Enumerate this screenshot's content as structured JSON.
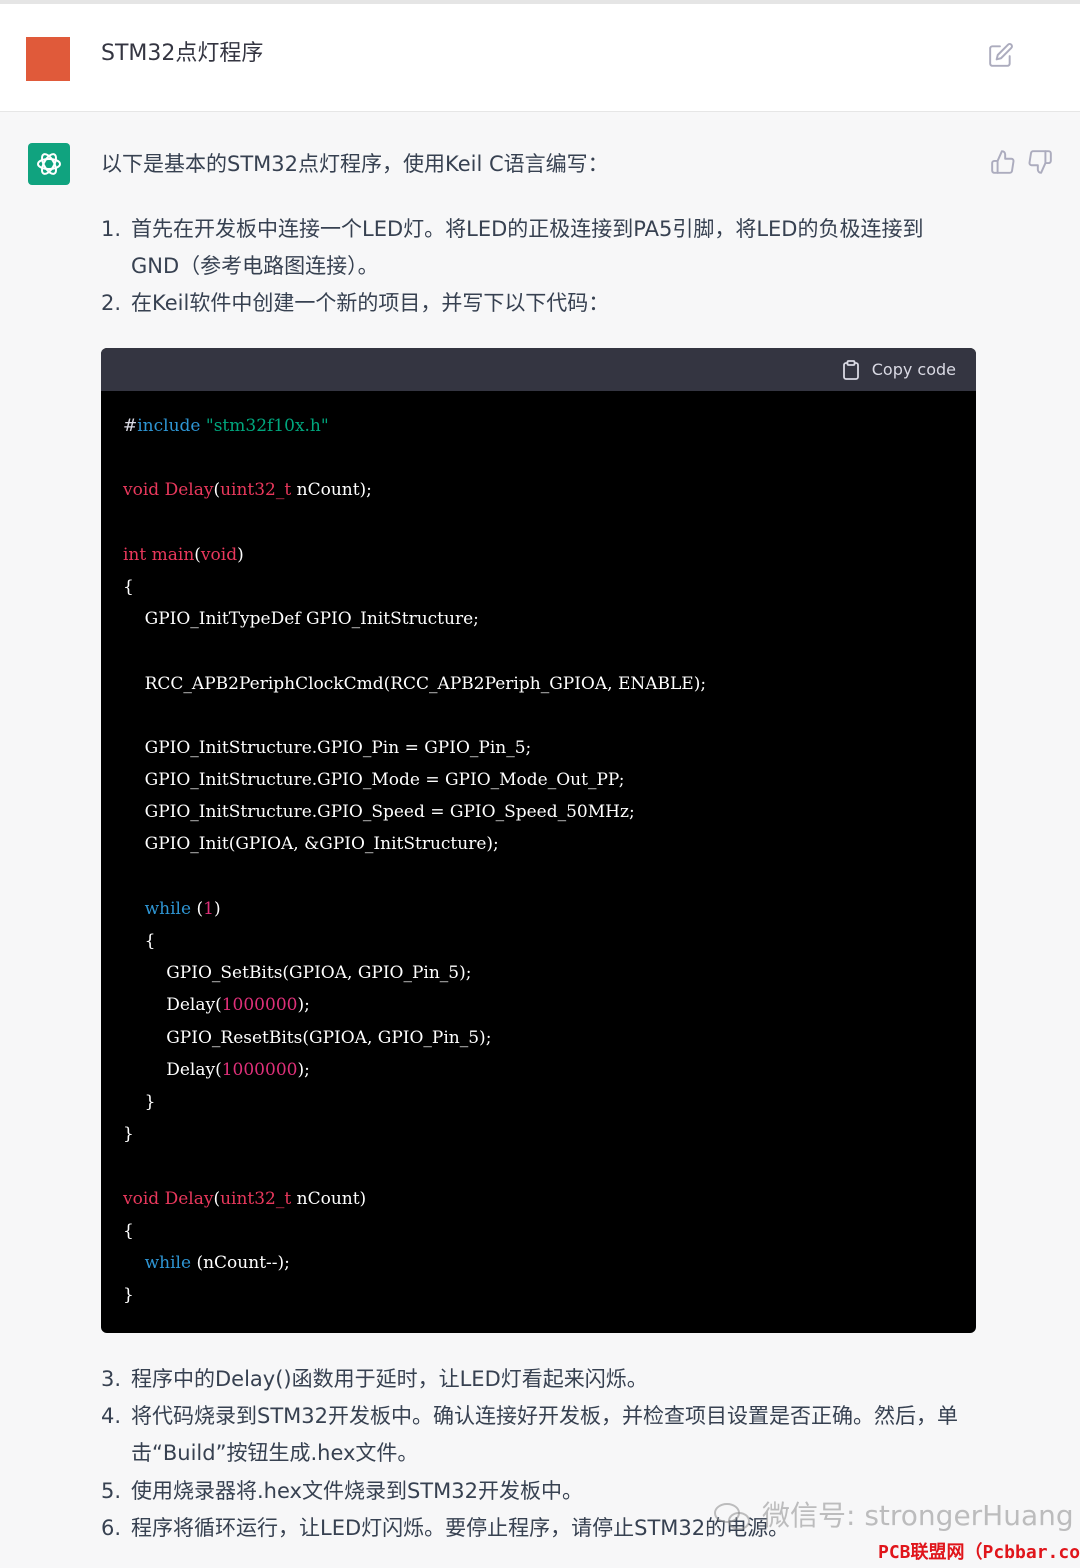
{
  "user_message": {
    "text": "STM32点灯程序"
  },
  "assistant": {
    "intro": "以下是基本的STM32点灯程序，使用Keil C语言编写：",
    "steps": [
      {
        "num": "1.",
        "line1": "首先在开发板中连接一个LED灯。将LED的正极连接到PA5引脚，将LED的负极连接到",
        "line2": "GND（参考电路图连接）。"
      },
      {
        "num": "2.",
        "line1": "在Keil软件中创建一个新的项目，并写下以下代码："
      },
      {
        "num": "3.",
        "line1": "程序中的Delay()函数用于延时，让LED灯看起来闪烁。"
      },
      {
        "num": "4.",
        "line1": "将代码烧录到STM32开发板中。确认连接好开发板，并检查项目设置是否正确。然后，单",
        "line2": "击“Build”按钮生成.hex文件。"
      },
      {
        "num": "5.",
        "line1": "使用烧录器将.hex文件烧录到STM32开发板中。"
      },
      {
        "num": "6.",
        "line1": "程序将循环运行，让LED灯闪烁。要停止程序，请停止STM32的电源。"
      }
    ],
    "code": {
      "copy_label": "Copy code",
      "lines": [
        [
          [
            "gy",
            "#"
          ],
          [
            "bl",
            "include "
          ],
          [
            "gr",
            "\"stm32f10x.h\""
          ]
        ],
        [],
        [
          [
            "kw",
            "void "
          ],
          [
            "kw",
            "Delay"
          ],
          [
            "wh",
            "("
          ],
          [
            "kw",
            "uint32_t "
          ],
          [
            "wh",
            "nCount);"
          ]
        ],
        [],
        [
          [
            "kw",
            "int "
          ],
          [
            "kw",
            "main"
          ],
          [
            "wh",
            "("
          ],
          [
            "kw",
            "void"
          ],
          [
            "wh",
            ")"
          ]
        ],
        [
          [
            "wh",
            "{"
          ]
        ],
        [
          [
            "wh",
            "    GPIO_InitTypeDef GPIO_InitStructure;"
          ]
        ],
        [],
        [
          [
            "wh",
            "    RCC_APB2PeriphClockCmd(RCC_APB2Periph_GPIOA, ENABLE);"
          ]
        ],
        [],
        [
          [
            "wh",
            "    GPIO_InitStructure.GPIO_Pin = GPIO_Pin_5;"
          ]
        ],
        [
          [
            "wh",
            "    GPIO_InitStructure.GPIO_Mode = GPIO_Mode_Out_PP;"
          ]
        ],
        [
          [
            "wh",
            "    GPIO_InitStructure.GPIO_Speed = GPIO_Speed_50MHz;"
          ]
        ],
        [
          [
            "wh",
            "    GPIO_Init(GPIOA, &GPIO_InitStructure);"
          ]
        ],
        [],
        [
          [
            "wh",
            "    "
          ],
          [
            "bl",
            "while "
          ],
          [
            "wh",
            "("
          ],
          [
            "pu",
            "1"
          ],
          [
            "wh",
            ")"
          ]
        ],
        [
          [
            "wh",
            "    {"
          ]
        ],
        [
          [
            "wh",
            "        GPIO_SetBits(GPIOA, GPIO_Pin_5);"
          ]
        ],
        [
          [
            "wh",
            "        Delay("
          ],
          [
            "pu",
            "1000000"
          ],
          [
            "wh",
            ");"
          ]
        ],
        [
          [
            "wh",
            "        GPIO_ResetBits(GPIOA, GPIO_Pin_5);"
          ]
        ],
        [
          [
            "wh",
            "        Delay("
          ],
          [
            "pu",
            "1000000"
          ],
          [
            "wh",
            ");"
          ]
        ],
        [
          [
            "wh",
            "    }"
          ]
        ],
        [
          [
            "wh",
            "}"
          ]
        ],
        [],
        [
          [
            "kw",
            "void "
          ],
          [
            "kw",
            "Delay"
          ],
          [
            "wh",
            "("
          ],
          [
            "kw",
            "uint32_t "
          ],
          [
            "wh",
            "nCount)"
          ]
        ],
        [
          [
            "wh",
            "{"
          ]
        ],
        [
          [
            "wh",
            "    "
          ],
          [
            "bl",
            "while "
          ],
          [
            "wh",
            "(nCount--);"
          ]
        ],
        [
          [
            "wh",
            "}"
          ]
        ]
      ]
    }
  },
  "watermark": {
    "text": "微信号: strongerHuang",
    "site": "PCB联盟网（Pcbbar.com）"
  },
  "colors": {
    "user_avatar": "#e05a3a",
    "bot_avatar": "#10a37f",
    "code_bg": "#000000",
    "code_header": "#343541"
  },
  "icons": [
    "edit-icon",
    "openai-logo-icon",
    "thumbs-up-icon",
    "thumbs-down-icon",
    "clipboard-icon",
    "wechat-icon"
  ]
}
